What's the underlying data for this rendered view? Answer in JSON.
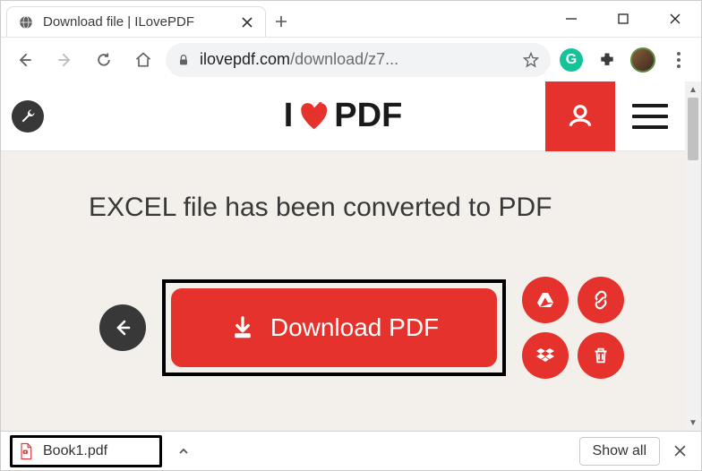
{
  "window": {
    "minimize": "minimize",
    "maximize": "maximize",
    "close": "close"
  },
  "tab": {
    "title": "Download file | ILovePDF",
    "close_label": "Close tab"
  },
  "newtab_label": "New tab",
  "toolbar": {
    "back": "Back",
    "forward": "Forward",
    "reload": "Reload",
    "home": "Home",
    "url_host": "ilovepdf.com",
    "url_path": "/download/z7...",
    "bookmark": "Bookmark",
    "grammarly": "G",
    "extensions": "Extensions",
    "profile": "Profile",
    "menu": "Menu"
  },
  "site": {
    "tools_label": "Tools",
    "logo_text_1": "I",
    "logo_text_2": "PDF",
    "account_label": "Account",
    "menu_label": "Menu"
  },
  "page": {
    "headline": "EXCEL file has been converted to PDF",
    "back_label": "Back",
    "download_label": "Download PDF",
    "actions": {
      "drive": "Save to Google Drive",
      "link": "Copy download link",
      "dropbox": "Save to Dropbox",
      "delete": "Delete file"
    }
  },
  "shelf": {
    "file_name": "Book1.pdf",
    "expand_label": "Options",
    "show_all_label": "Show all",
    "close_label": "Close"
  },
  "colors": {
    "accent": "#e5322d",
    "dark": "#383838"
  }
}
